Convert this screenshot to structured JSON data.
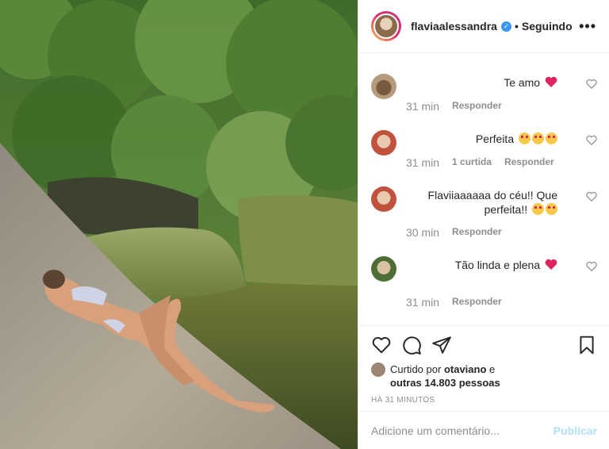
{
  "post": {
    "username": "flaviaalessandra",
    "verified_badge": "✓",
    "separator": "•",
    "follow_status": "Seguindo",
    "more_icon": "•••"
  },
  "comments": [
    {
      "text": "Te amo",
      "emoji": "heart-emoji",
      "time": "31 min",
      "replies": "",
      "reply_label": "Responder"
    },
    {
      "text": "Perfeita",
      "emoji": "star-struck-emoji x3",
      "time": "31 min",
      "replies": "1 curtida",
      "reply_label": "Responder"
    },
    {
      "text": "Flaviiaaaaaa do céu!! Que perfeita!!",
      "emoji": "star-struck-emoji x2",
      "time": "30 min",
      "replies": "",
      "reply_label": "Responder"
    },
    {
      "text": "Tão linda e plena",
      "emoji": "heart-emoji",
      "time": "31 min",
      "replies": "",
      "reply_label": "Responder"
    }
  ],
  "likes": {
    "prefix": "Curtido por",
    "user": "otaviano",
    "conj": "e",
    "others": "outras 14.803 pessoas"
  },
  "timestamp": "HÁ 31 MINUTOS",
  "composer": {
    "placeholder": "Adicione um comentário...",
    "publish_label": "Publicar"
  },
  "colors": {
    "publish_disabled": "#b2dffc",
    "verified": "#3897f0",
    "heart": "#e0245e"
  }
}
